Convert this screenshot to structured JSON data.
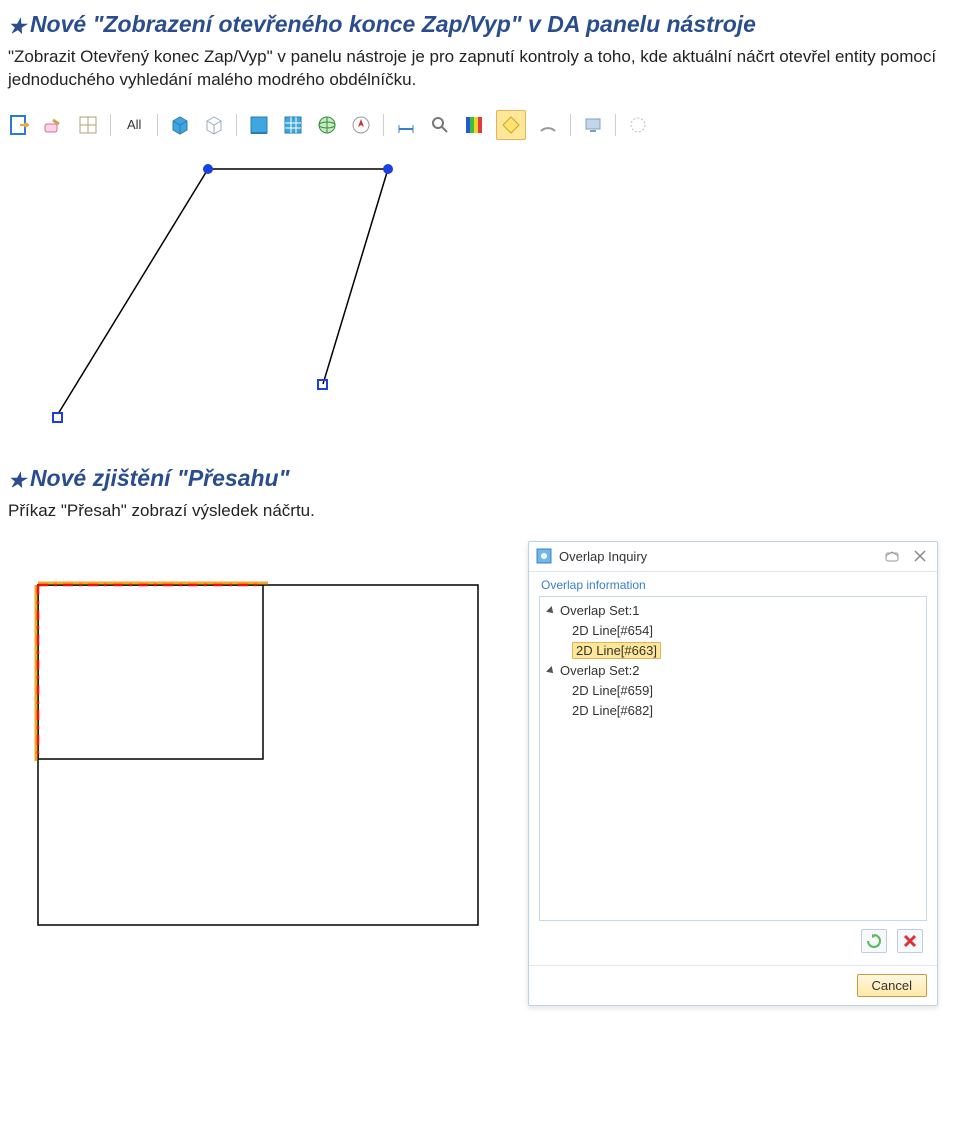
{
  "section1": {
    "heading": "Nové \"Zobrazení otevřeného konce Zap/Vyp\" v DA panelu nástroje",
    "body": "\"Zobrazit Otevřený konec Zap/Vyp\" v panelu nástroje je pro zapnutí kontroly a toho, kde aktuální náčrt otevřel entity pomocí jednoduchého vyhledání malého modrého obdélníčku."
  },
  "toolbar1": {
    "filter_label": "All"
  },
  "section2": {
    "heading": "Nové zjištění \"Přesahu\"",
    "body": "Příkaz \"Přesah\" zobrazí výsledek náčrtu."
  },
  "overlap_panel": {
    "title": "Overlap Inquiry",
    "group_label": "Overlap information",
    "tree": [
      {
        "type": "group",
        "label": "Overlap Set:1"
      },
      {
        "type": "item",
        "label": "2D Line[#654]"
      },
      {
        "type": "item",
        "label": "2D Line[#663]",
        "selected": true
      },
      {
        "type": "group",
        "label": "Overlap Set:2"
      },
      {
        "type": "item",
        "label": "2D Line[#659]"
      },
      {
        "type": "item",
        "label": "2D Line[#682]"
      }
    ],
    "cancel_label": "Cancel"
  }
}
